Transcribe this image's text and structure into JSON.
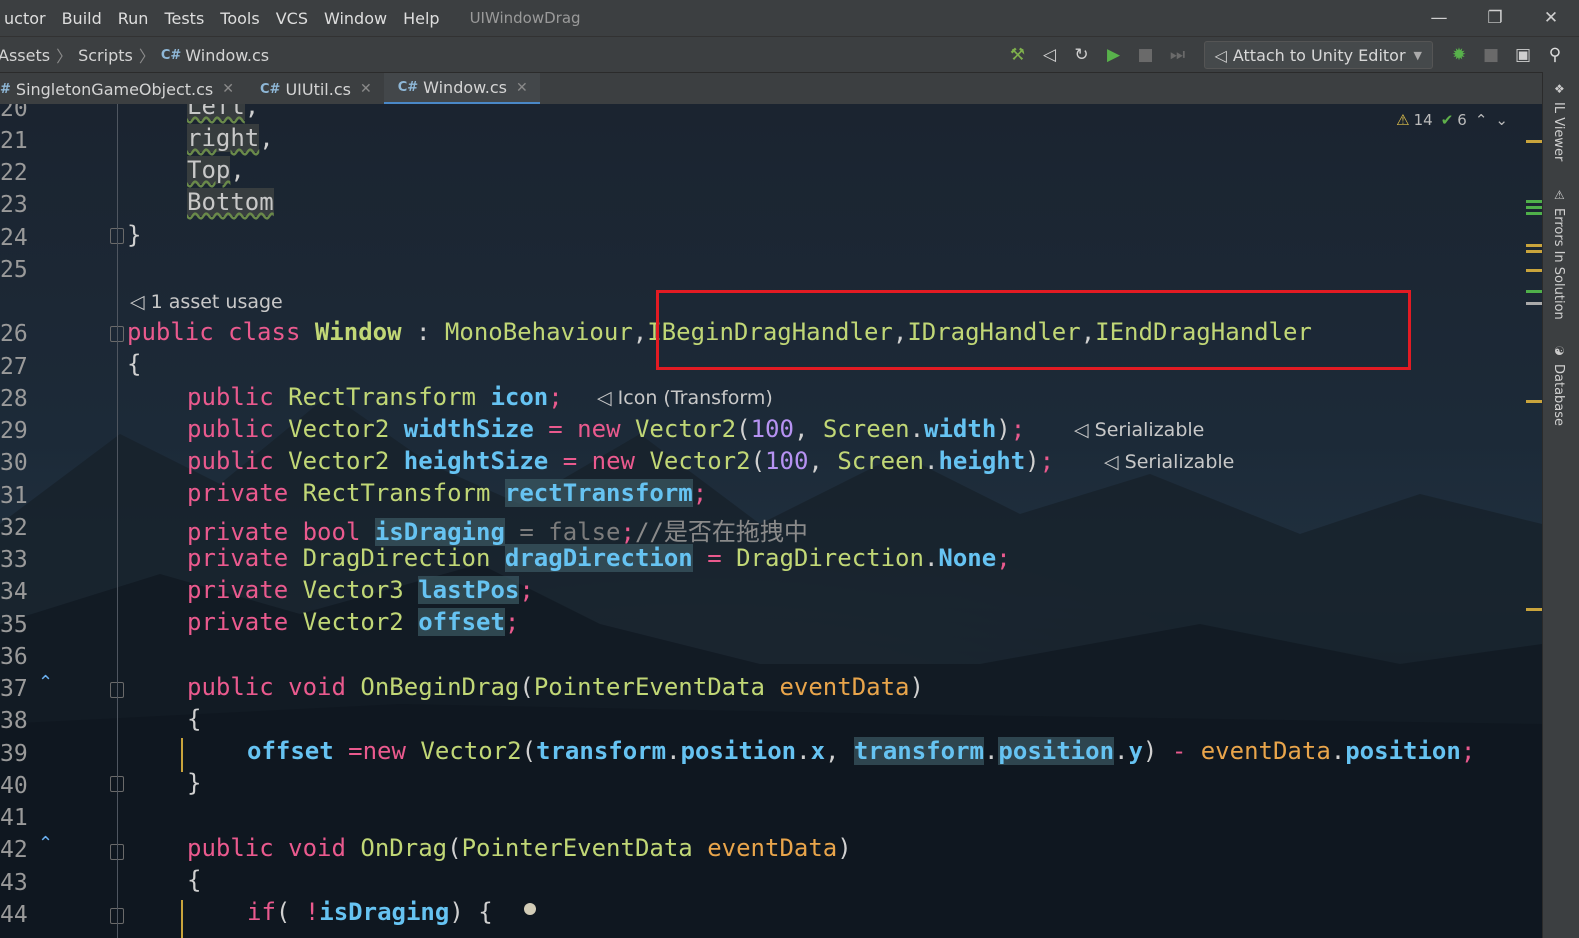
{
  "menu": {
    "items": [
      "uctor",
      "Build",
      "Run",
      "Tests",
      "Tools",
      "VCS",
      "Window",
      "Help"
    ],
    "window_title": "UIWindowDrag",
    "controls": [
      "minimize",
      "restore",
      "close"
    ]
  },
  "breadcrumb": {
    "items": [
      "Assets",
      "Scripts",
      "Window.cs"
    ],
    "file_badge": "C#"
  },
  "toolbar": {
    "attach_label": "Attach to Unity Editor",
    "icons": [
      "hammer-icon",
      "unity-icon",
      "refresh-icon",
      "run-icon",
      "stop-icon",
      "step-icon",
      "bug-icon",
      "stop-debug-icon",
      "layout-icon",
      "search-icon"
    ]
  },
  "tabs": [
    {
      "label": "SingletonGameObject.cs",
      "badge": "#",
      "active": false
    },
    {
      "label": "UIUtil.cs",
      "badge": "C#",
      "active": false
    },
    {
      "label": "Window.cs",
      "badge": "C#",
      "active": true
    }
  ],
  "inspection": {
    "warnings": "14",
    "ok": "6"
  },
  "right_panels": [
    "IL Viewer",
    "Errors In Solution",
    "Database"
  ],
  "hints": {
    "asset_usage": "1 asset usage",
    "icon_hint": "Icon (Transform)",
    "serializable1": "Serializable",
    "serializable2": "Serializable"
  },
  "line_numbers": [
    "20",
    "21",
    "22",
    "23",
    "24",
    "25",
    "26",
    "27",
    "28",
    "29",
    "30",
    "31",
    "32",
    "33",
    "34",
    "35",
    "36",
    "37",
    "38",
    "39",
    "40",
    "41",
    "42",
    "43",
    "44"
  ],
  "code": {
    "l20": "Left",
    "l21": "right",
    "l22": "Top",
    "l23": "Bottom",
    "brace_close": "}",
    "brace_open": "{",
    "class_public": "public",
    "class_kw": "class",
    "class_name": "Window",
    "class_colon": ":",
    "base1": "MonoBehaviour",
    "base2": "IBeginDragHandler",
    "base3": "IDragHandler",
    "base4": "IEndDragHandler",
    "comment_cn": "//是否在拖拽中"
  },
  "colors": {
    "keyword": "#ea5a8e",
    "type": "#c1d776",
    "field": "#66c3f2",
    "param": "#e9a54b",
    "number": "#b692f2",
    "highlight_box": "#e21b23",
    "active_tab_underline": "#4a88c7"
  }
}
